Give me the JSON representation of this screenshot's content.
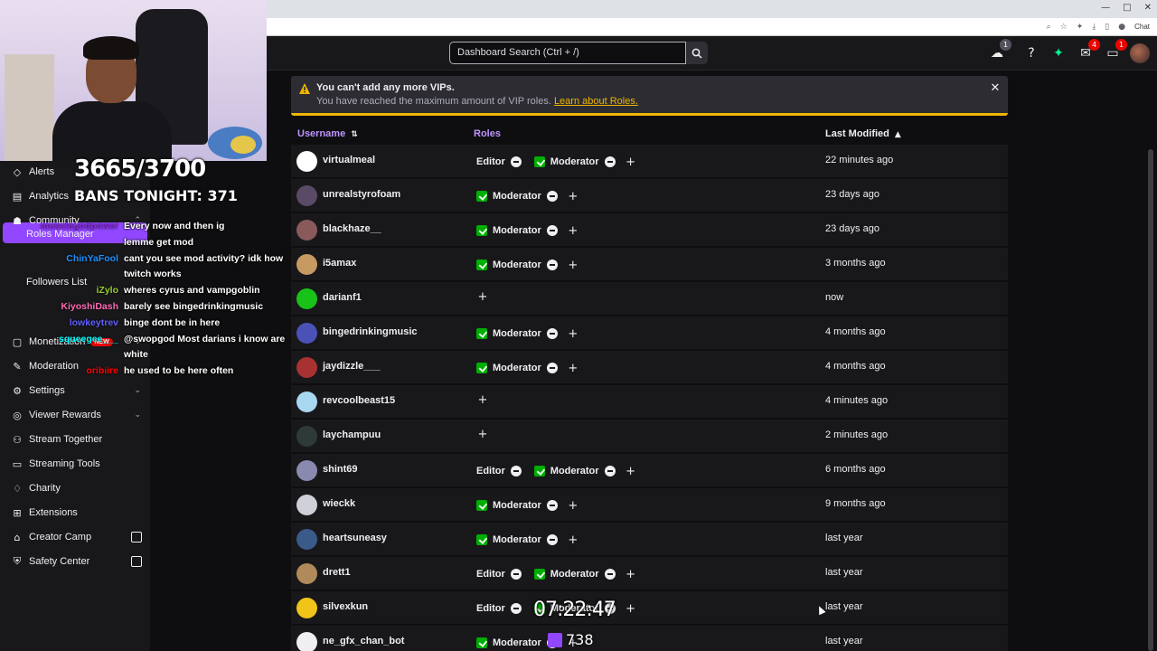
{
  "browser": {
    "controls": [
      "—",
      "□",
      "✕"
    ],
    "chat_label": "Chat"
  },
  "topnav": {
    "search_placeholder": "Dashboard Search (Ctrl + /)",
    "badges": {
      "crowd": "1",
      "inbox": "4",
      "notifications": "1"
    },
    "icons": [
      "crowd-icon",
      "help-icon",
      "sparkle-icon",
      "inbox-icon",
      "notifications-icon",
      "avatar"
    ]
  },
  "overlay": {
    "count": "3665/3700",
    "bans": "BANS TONIGHT: 371",
    "timer": "07:22:47",
    "viewers": "738"
  },
  "sidebar": {
    "items": [
      {
        "label": "Alerts",
        "icon": "alerts-icon"
      },
      {
        "label": "Analytics",
        "icon": "analytics-icon",
        "chevron": "down"
      },
      {
        "label": "Community",
        "icon": "community-icon",
        "chevron": "up"
      },
      {
        "label": "Monetization",
        "icon": "monetization-icon",
        "badge": "NEW",
        "chevron": "down"
      },
      {
        "label": "Moderation",
        "icon": "moderation-icon"
      },
      {
        "label": "Settings",
        "icon": "settings-icon",
        "chevron": "down"
      },
      {
        "label": "Viewer Rewards",
        "icon": "rewards-icon",
        "chevron": "down"
      },
      {
        "label": "Stream Together",
        "icon": "stream-together-icon"
      },
      {
        "label": "Streaming Tools",
        "icon": "streaming-tools-icon"
      },
      {
        "label": "Charity",
        "icon": "charity-icon"
      },
      {
        "label": "Extensions",
        "icon": "extensions-icon"
      },
      {
        "label": "Creator Camp",
        "icon": "creator-camp-icon",
        "external": true
      },
      {
        "label": "Safety Center",
        "icon": "safety-center-icon",
        "external": true
      }
    ],
    "subitems": {
      "roles_manager": "Roles Manager",
      "followers_list": "Followers List"
    }
  },
  "chat": [
    {
      "name": "musclegodpower",
      "color": "#8a2be2",
      "text": "Every now and then ig"
    },
    {
      "name": "",
      "color": "#ffffff",
      "text": "lemme get mod"
    },
    {
      "name": "ChinYaFool",
      "color": "#1e90ff",
      "text": "cant you see mod activity? idk how"
    },
    {
      "name": "",
      "color": "#ffffff",
      "text": "twitch works"
    },
    {
      "name": "iZylo",
      "color": "#9acd32",
      "text": "wheres cyrus and vampgoblin"
    },
    {
      "name": "KiyoshiDash",
      "color": "#ff69b4",
      "text": "barely see bingedrinkingmusic"
    },
    {
      "name": "lowkeytrev",
      "color": "#5f5fff",
      "text": "binge dont be in here"
    },
    {
      "name": "squeegee___",
      "color": "#00ffff",
      "text": "@swopgod Most darians i know are"
    },
    {
      "name": "",
      "color": "#ffffff",
      "text": "white"
    },
    {
      "name": "oribiire",
      "color": "#ff0000",
      "text": "he used to be here often"
    }
  ],
  "alert": {
    "title": "You can't add any more VIPs.",
    "body": "You have reached the maximum amount of VIP roles.",
    "link": "Learn about Roles."
  },
  "table": {
    "headers": {
      "username": "Username",
      "roles": "Roles",
      "modified": "Last Modified"
    },
    "rows": [
      {
        "user": "virtualmeal",
        "roles": [
          "Editor",
          "Moderator"
        ],
        "modified": "22 minutes ago",
        "avatar": "#ffffff"
      },
      {
        "user": "unrealstyrofoam",
        "roles": [
          "Moderator"
        ],
        "modified": "23 days ago",
        "avatar": "#5a4a66"
      },
      {
        "user": "blackhaze__",
        "roles": [
          "Moderator"
        ],
        "modified": "23 days ago",
        "avatar": "#8a5a5a"
      },
      {
        "user": "i5amax",
        "roles": [
          "Moderator"
        ],
        "modified": "3 months ago",
        "avatar": "#c79a62"
      },
      {
        "user": "darianf1",
        "roles": [],
        "modified": "now",
        "avatar": "#19c219"
      },
      {
        "user": "bingedrinkingmusic",
        "roles": [
          "Moderator"
        ],
        "modified": "4 months ago",
        "avatar": "#4a52b8"
      },
      {
        "user": "jaydizzle___",
        "roles": [
          "Moderator"
        ],
        "modified": "4 months ago",
        "avatar": "#a83232"
      },
      {
        "user": "revcoolbeast15",
        "roles": [],
        "modified": "4 minutes ago",
        "avatar": "#a8d8f0"
      },
      {
        "user": "laychampuu",
        "roles": [],
        "modified": "2 minutes ago",
        "avatar": "#2e3a3a"
      },
      {
        "user": "shint69",
        "roles": [
          "Editor",
          "Moderator"
        ],
        "modified": "6 months ago",
        "avatar": "#8a8ab0"
      },
      {
        "user": "wieckk",
        "roles": [
          "Moderator"
        ],
        "modified": "9 months ago",
        "avatar": "#d0d0d8"
      },
      {
        "user": "heartsuneasy",
        "roles": [
          "Moderator"
        ],
        "modified": "last year",
        "avatar": "#3a5a8a"
      },
      {
        "user": "drett1",
        "roles": [
          "Editor",
          "Moderator"
        ],
        "modified": "last year",
        "avatar": "#b08a5a"
      },
      {
        "user": "silvexkun",
        "roles": [
          "Editor",
          "Moderator"
        ],
        "modified": "last year",
        "avatar": "#f0c419"
      },
      {
        "user": "ne_gfx_chan_bot",
        "roles": [
          "Moderator"
        ],
        "modified": "last year",
        "avatar": "#efeff1"
      }
    ]
  }
}
